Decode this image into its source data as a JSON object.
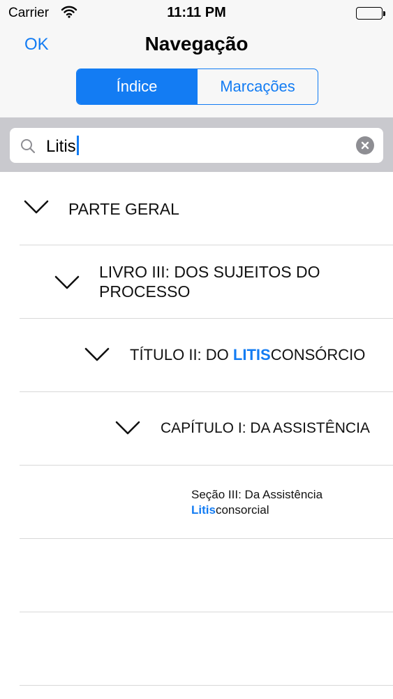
{
  "status_bar": {
    "carrier": "Carrier",
    "time": "11:11 PM"
  },
  "nav": {
    "ok_label": "OK",
    "title": "Navegação"
  },
  "segments": [
    {
      "label": "Índice",
      "selected": true
    },
    {
      "label": "Marcações",
      "selected": false
    }
  ],
  "search": {
    "value": "Litis"
  },
  "tree": [
    {
      "pre": "PARTE GERAL",
      "hl": "",
      "post": ""
    },
    {
      "pre": "LIVRO III: DOS SUJEITOS DO PROCESSO",
      "hl": "",
      "post": ""
    },
    {
      "pre": "TÍTULO II: DO ",
      "hl": "LITIS",
      "post": "CONSÓRCIO"
    },
    {
      "pre": "CAPÍTULO I: DA ASSISTÊNCIA",
      "hl": "",
      "post": ""
    },
    {
      "pre": "Seção III: Da Assistência ",
      "hl": "Litis",
      "post": "consorcial"
    }
  ],
  "colors": {
    "accent": "#137cf3",
    "search_bar_bg": "#c9c9ce",
    "header_bg": "#f7f7f7"
  }
}
